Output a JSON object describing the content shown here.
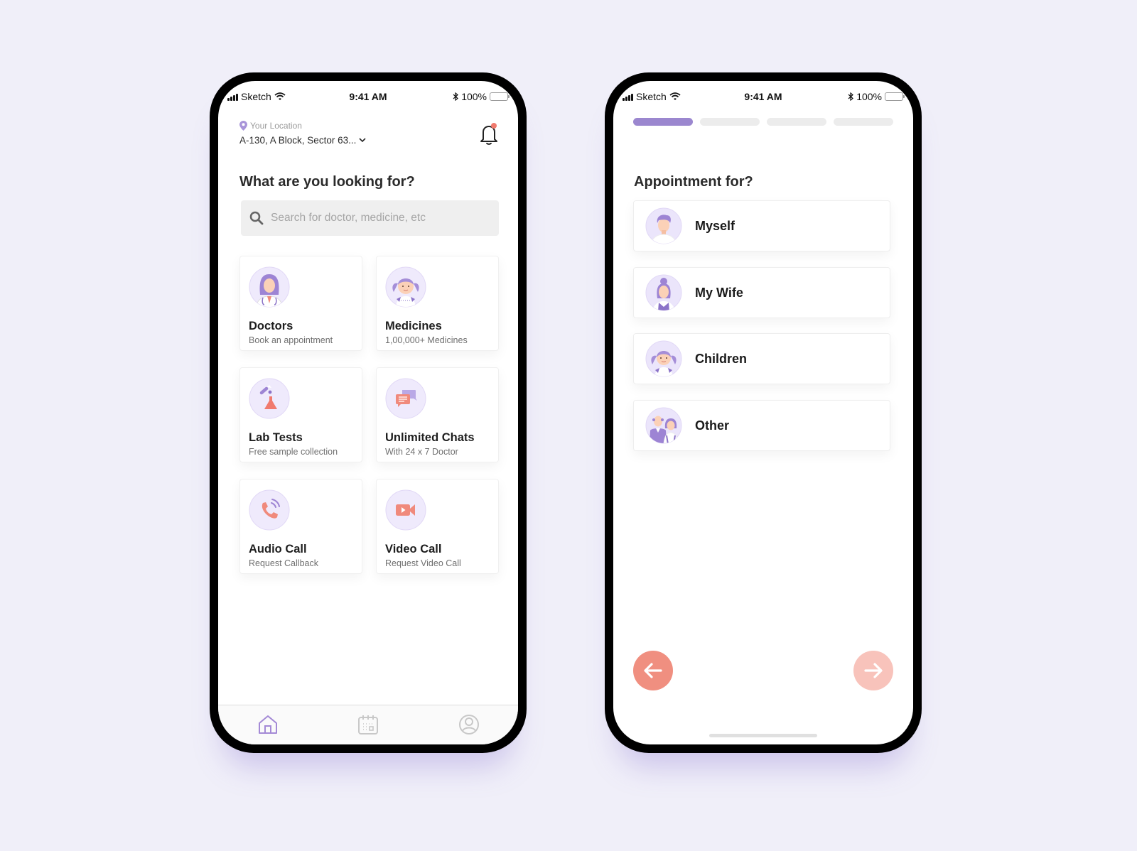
{
  "colors": {
    "background": "#f0eff9",
    "accent_purple": "#9b87cf",
    "accent_coral": "#f08f80",
    "coral_disabled": "#f8c3bb",
    "notification_dot": "#f07a6e"
  },
  "status_bar": {
    "carrier": "Sketch",
    "time": "9:41 AM",
    "battery": "100%",
    "battery_level": 1.0
  },
  "home_screen": {
    "location": {
      "label": "Your Location",
      "value": "A-130, A Block, Sector 63...",
      "icon": "map-pin-icon"
    },
    "notification_icon": "bell-icon",
    "has_notification": true,
    "heading": "What are you looking for?",
    "search": {
      "placeholder": "Search for doctor, medicine, etc",
      "value": ""
    },
    "services": [
      {
        "title": "Doctors",
        "subtitle": "Book an appointment",
        "icon": "doctor-avatar-icon"
      },
      {
        "title": "Medicines",
        "subtitle": "1,00,000+ Medicines",
        "icon": "girl-avatar-icon"
      },
      {
        "title": "Lab Tests",
        "subtitle": "Free sample collection",
        "icon": "flask-icon"
      },
      {
        "title": "Unlimited Chats",
        "subtitle": "With 24 x 7 Doctor",
        "icon": "chat-bubbles-icon"
      },
      {
        "title": "Audio Call",
        "subtitle": "Request Callback",
        "icon": "phone-call-icon"
      },
      {
        "title": "Video Call",
        "subtitle": "Request Video Call",
        "icon": "video-camera-icon"
      }
    ],
    "tabbar": [
      {
        "name": "home",
        "icon": "home-icon",
        "active": true
      },
      {
        "name": "appointments",
        "icon": "calendar-icon",
        "active": false
      },
      {
        "name": "profile",
        "icon": "user-circle-icon",
        "active": false
      }
    ]
  },
  "appointment_screen": {
    "progress": {
      "current_step": 1,
      "total_steps": 4
    },
    "heading": "Appointment for?",
    "options": [
      {
        "label": "Myself",
        "icon": "man-avatar-icon"
      },
      {
        "label": "My Wife",
        "icon": "woman-avatar-icon"
      },
      {
        "label": "Children",
        "icon": "girl-avatar-icon"
      },
      {
        "label": "Other",
        "icon": "elderly-couple-avatar-icon"
      }
    ],
    "back_button": {
      "icon": "arrow-left-icon",
      "enabled": true
    },
    "next_button": {
      "icon": "arrow-right-icon",
      "enabled": false
    }
  }
}
